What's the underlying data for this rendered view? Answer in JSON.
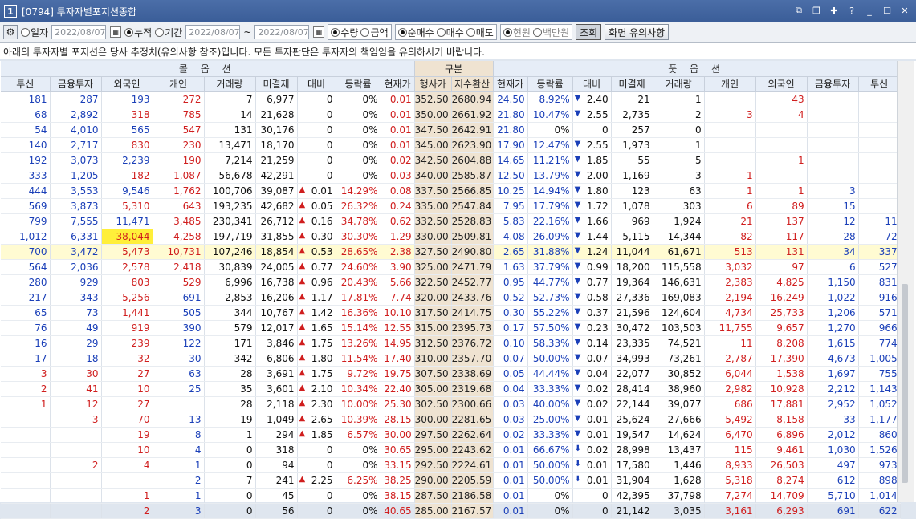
{
  "window": {
    "number": "1",
    "title": "[0794] 투자자별포지션종합"
  },
  "toolbar": {
    "r_day": "일자",
    "date1": "2022/08/07",
    "r_cum": "누적",
    "r_period": "기간",
    "date2": "2022/08/07",
    "tilde": "~",
    "date3": "2022/08/07",
    "r_qty": "수량",
    "r_amt": "금액",
    "r_netbuy": "순매수",
    "r_buy": "매수",
    "r_sell": "매도",
    "r_won": "현원",
    "r_million": "백만원",
    "btn_query": "조회",
    "btn_notice": "화면 유의사항"
  },
  "notice": "아래의 투자자별 포지션은 당사 추정치(유의사항 참조)입니다. 모든 투자판단은 투자자의 책임임을 유의하시기 바랍니다.",
  "headers": {
    "call": "콜 옵 션",
    "mid": "구분",
    "put": "풋 옵 션",
    "cols": [
      "투신",
      "금융투자",
      "외국인",
      "개인",
      "거래량",
      "미결제",
      "대비",
      "등락률",
      "현재가",
      "행사가",
      "지수환산",
      "현재가",
      "등락률",
      "대비",
      "미결제",
      "거래량",
      "개인",
      "외국인",
      "금융투자",
      "투신"
    ]
  },
  "rows": [
    [
      "181",
      "287",
      "193",
      "272",
      "7",
      "6,977",
      "0",
      "0%",
      "0.01",
      "352.50",
      "2680.94",
      "24.50",
      "8.92%",
      "2.40",
      "21",
      "1",
      "",
      "43",
      "",
      ""
    ],
    [
      "68",
      "2,892",
      "318",
      "785",
      "14",
      "21,628",
      "0",
      "0%",
      "0.01",
      "350.00",
      "2661.92",
      "21.80",
      "10.47%",
      "2.55",
      "2,735",
      "2",
      "3",
      "4",
      "",
      ""
    ],
    [
      "54",
      "4,010",
      "565",
      "547",
      "131",
      "30,176",
      "0",
      "0%",
      "0.01",
      "347.50",
      "2642.91",
      "21.80",
      "0%",
      "0",
      "257",
      "0",
      "",
      "",
      "",
      ""
    ],
    [
      "140",
      "2,717",
      "830",
      "230",
      "13,471",
      "18,170",
      "0",
      "0%",
      "0.01",
      "345.00",
      "2623.90",
      "17.90",
      "12.47%",
      "2.55",
      "1,973",
      "1",
      "",
      "",
      "",
      ""
    ],
    [
      "192",
      "3,073",
      "2,239",
      "190",
      "7,214",
      "21,259",
      "0",
      "0%",
      "0.02",
      "342.50",
      "2604.88",
      "14.65",
      "11.21%",
      "1.85",
      "55",
      "5",
      "",
      "1",
      "",
      ""
    ],
    [
      "333",
      "1,205",
      "182",
      "1,087",
      "56,678",
      "42,291",
      "0",
      "0%",
      "0.03",
      "340.00",
      "2585.87",
      "12.50",
      "13.79%",
      "2.00",
      "1,169",
      "3",
      "1",
      "",
      "",
      ""
    ],
    [
      "444",
      "3,553",
      "9,546",
      "1,762",
      "100,706",
      "39,087",
      "0.01",
      "14.29%",
      "0.08",
      "337.50",
      "2566.85",
      "10.25",
      "14.94%",
      "1.80",
      "123",
      "63",
      "1",
      "1",
      "3",
      ""
    ],
    [
      "569",
      "3,873",
      "5,310",
      "643",
      "193,235",
      "42,682",
      "0.05",
      "26.32%",
      "0.24",
      "335.00",
      "2547.84",
      "7.95",
      "17.79%",
      "1.72",
      "1,078",
      "303",
      "6",
      "89",
      "15",
      ""
    ],
    [
      "799",
      "7,555",
      "11,471",
      "3,485",
      "230,341",
      "26,712",
      "0.16",
      "34.78%",
      "0.62",
      "332.50",
      "2528.83",
      "5.83",
      "22.16%",
      "1.66",
      "969",
      "1,924",
      "21",
      "137",
      "12",
      "11"
    ],
    [
      "1,012",
      "6,331",
      "38,044",
      "4,258",
      "197,719",
      "31,855",
      "0.30",
      "30.30%",
      "1.29",
      "330.00",
      "2509.81",
      "4.08",
      "26.09%",
      "1.44",
      "5,115",
      "14,344",
      "82",
      "117",
      "28",
      "72"
    ],
    [
      "700",
      "3,472",
      "5,473",
      "10,731",
      "107,246",
      "18,854",
      "0.53",
      "28.65%",
      "2.38",
      "327.50",
      "2490.80",
      "2.65",
      "31.88%",
      "1.24",
      "11,044",
      "61,671",
      "513",
      "131",
      "34",
      "337"
    ],
    [
      "564",
      "2,036",
      "2,578",
      "2,418",
      "30,839",
      "24,005",
      "0.77",
      "24.60%",
      "3.90",
      "325.00",
      "2471.79",
      "1.63",
      "37.79%",
      "0.99",
      "18,200",
      "115,558",
      "3,032",
      "97",
      "6",
      "527"
    ],
    [
      "280",
      "929",
      "803",
      "529",
      "6,996",
      "16,738",
      "0.96",
      "20.43%",
      "5.66",
      "322.50",
      "2452.77",
      "0.95",
      "44.77%",
      "0.77",
      "19,364",
      "146,631",
      "2,383",
      "4,825",
      "1,150",
      "831"
    ],
    [
      "217",
      "343",
      "5,256",
      "691",
      "2,853",
      "16,206",
      "1.17",
      "17.81%",
      "7.74",
      "320.00",
      "2433.76",
      "0.52",
      "52.73%",
      "0.58",
      "27,336",
      "169,083",
      "2,194",
      "16,249",
      "1,022",
      "916"
    ],
    [
      "65",
      "73",
      "1,441",
      "505",
      "344",
      "10,767",
      "1.42",
      "16.36%",
      "10.10",
      "317.50",
      "2414.75",
      "0.30",
      "55.22%",
      "0.37",
      "21,596",
      "124,604",
      "4,734",
      "25,733",
      "1,206",
      "571"
    ],
    [
      "76",
      "49",
      "919",
      "390",
      "579",
      "12,017",
      "1.65",
      "15.14%",
      "12.55",
      "315.00",
      "2395.73",
      "0.17",
      "57.50%",
      "0.23",
      "30,472",
      "103,503",
      "11,755",
      "9,657",
      "1,270",
      "966"
    ],
    [
      "16",
      "29",
      "239",
      "122",
      "171",
      "3,846",
      "1.75",
      "13.26%",
      "14.95",
      "312.50",
      "2376.72",
      "0.10",
      "58.33%",
      "0.14",
      "23,335",
      "74,521",
      "11",
      "8,208",
      "1,615",
      "774"
    ],
    [
      "17",
      "18",
      "32",
      "30",
      "342",
      "6,806",
      "1.80",
      "11.54%",
      "17.40",
      "310.00",
      "2357.70",
      "0.07",
      "50.00%",
      "0.07",
      "34,993",
      "73,261",
      "2,787",
      "17,390",
      "4,673",
      "1,005"
    ],
    [
      "3",
      "30",
      "27",
      "63",
      "28",
      "3,691",
      "1.75",
      "9.72%",
      "19.75",
      "307.50",
      "2338.69",
      "0.05",
      "44.44%",
      "0.04",
      "22,077",
      "30,852",
      "6,044",
      "1,538",
      "1,697",
      "755"
    ],
    [
      "2",
      "41",
      "10",
      "25",
      "35",
      "3,601",
      "2.10",
      "10.34%",
      "22.40",
      "305.00",
      "2319.68",
      "0.04",
      "33.33%",
      "0.02",
      "28,414",
      "38,960",
      "2,982",
      "10,928",
      "2,212",
      "1,143"
    ],
    [
      "1",
      "12",
      "27",
      "",
      "28",
      "2,118",
      "2.30",
      "10.00%",
      "25.30",
      "302.50",
      "2300.66",
      "0.03",
      "40.00%",
      "0.02",
      "22,144",
      "39,077",
      "686",
      "17,881",
      "2,952",
      "1,052"
    ],
    [
      "",
      "3",
      "70",
      "13",
      "19",
      "1,049",
      "2.65",
      "10.39%",
      "28.15",
      "300.00",
      "2281.65",
      "0.03",
      "25.00%",
      "0.01",
      "25,624",
      "27,666",
      "5,492",
      "8,158",
      "33",
      "1,177"
    ],
    [
      "",
      "",
      "19",
      "8",
      "1",
      "294",
      "1.85",
      "6.57%",
      "30.00",
      "297.50",
      "2262.64",
      "0.02",
      "33.33%",
      "0.01",
      "19,547",
      "14,624",
      "6,470",
      "6,896",
      "2,012",
      "860"
    ],
    [
      "",
      "",
      "10",
      "4",
      "0",
      "318",
      "0",
      "0%",
      "30.65",
      "295.00",
      "2243.62",
      "0.01",
      "66.67%",
      "0.02",
      "28,998",
      "13,437",
      "115",
      "9,461",
      "1,030",
      "1,526"
    ],
    [
      "",
      "2",
      "4",
      "1",
      "0",
      "94",
      "0",
      "0%",
      "33.15",
      "292.50",
      "2224.61",
      "0.01",
      "50.00%",
      "0.01",
      "17,580",
      "1,446",
      "8,933",
      "26,503",
      "497",
      "973"
    ],
    [
      "",
      "",
      "",
      "2",
      "7",
      "241",
      "2.25",
      "6.25%",
      "38.25",
      "290.00",
      "2205.59",
      "0.01",
      "50.00%",
      "0.01",
      "31,904",
      "1,628",
      "5,318",
      "8,274",
      "612",
      "898"
    ],
    [
      "",
      "",
      "1",
      "1",
      "0",
      "45",
      "0",
      "0%",
      "38.15",
      "287.50",
      "2186.58",
      "0.01",
      "0%",
      "0",
      "42,395",
      "37,798",
      "7,274",
      "14,709",
      "5,710",
      "1,014"
    ],
    [
      "",
      "",
      "2",
      "3",
      "0",
      "56",
      "0",
      "0%",
      "40.65",
      "285.00",
      "2167.57",
      "0.01",
      "0%",
      "0",
      "21,142",
      "3,035",
      "3,161",
      "6,293",
      "691",
      "622"
    ]
  ],
  "colors": {
    "title_bg": "#3f62a0",
    "negative": "#1a3fb8",
    "positive": "#d01e1e",
    "highlight": "#ffef3a",
    "mid_col": "#efe3d1"
  },
  "icons": [
    "gear-icon",
    "calendar-icon",
    "minimize-icon",
    "maximize-icon",
    "close-icon",
    "pin-icon",
    "help-icon"
  ]
}
